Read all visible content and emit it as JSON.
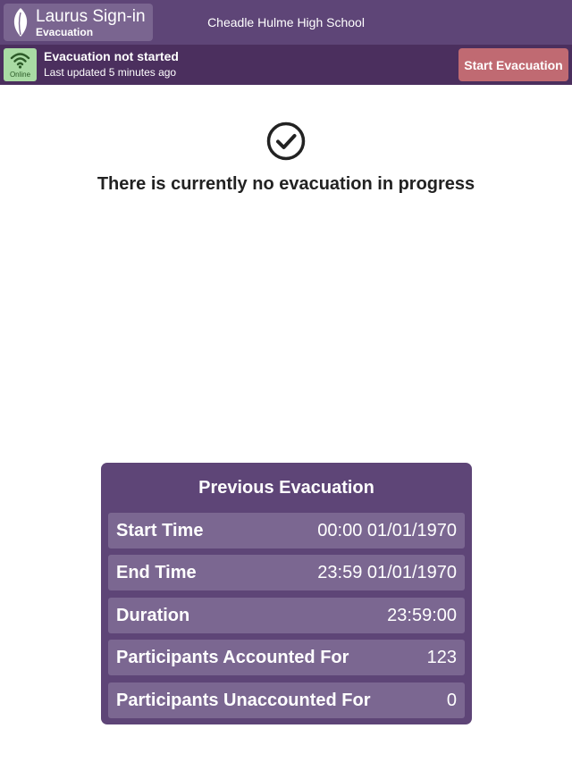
{
  "header": {
    "app_title": "Laurus Sign-in",
    "app_subtitle": "Evacuation",
    "school_name": "Cheadle Hulme High School",
    "logo_icon": "leaf-icon"
  },
  "status": {
    "connection_label": "Online",
    "connection_icon": "wifi-icon",
    "title": "Evacuation not started",
    "last_updated": "Last updated 5 minutes ago",
    "start_button_label": "Start Evacuation"
  },
  "main": {
    "status_icon": "check-circle-icon",
    "message": "There is currently no evacuation in progress"
  },
  "previous_evacuation": {
    "title": "Previous Evacuation",
    "rows": [
      {
        "label": "Start Time",
        "value": "00:00 01/01/1970"
      },
      {
        "label": "End Time",
        "value": "23:59 01/01/1970"
      },
      {
        "label": "Duration",
        "value": "23:59:00"
      },
      {
        "label": "Participants Accounted For",
        "value": "123"
      },
      {
        "label": "Participants Unaccounted For",
        "value": "0"
      }
    ]
  },
  "colors": {
    "header_bg": "#5e4577",
    "status_bg": "#4b2f5e",
    "start_button": "#c06a72",
    "online_badge": "#a9dba4",
    "panel_row": "#7b6791"
  }
}
